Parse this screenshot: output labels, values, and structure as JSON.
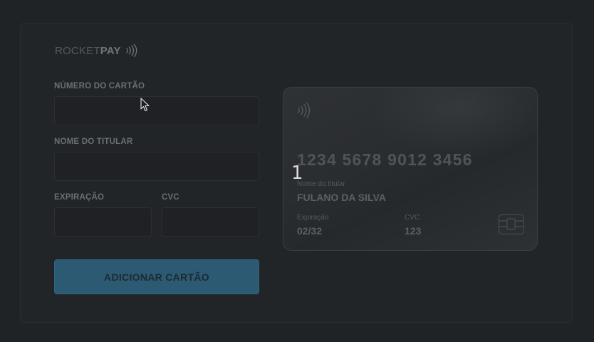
{
  "brand": {
    "name_light": "ROCKET",
    "name_bold": "PAY"
  },
  "form": {
    "card_number_label": "NÚMERO DO CARTÃO",
    "card_number_value": "",
    "holder_label": "NOME DO TITULAR",
    "holder_value": "",
    "expiration_label": "EXPIRAÇÃO",
    "expiration_value": "",
    "cvc_label": "CVC",
    "cvc_value": "",
    "submit_label": "ADICIONAR CARTÃO"
  },
  "card": {
    "number": "1234 5678 9012 3456",
    "holder_caption": "Nome do titular",
    "holder_name": "FULANO DA SILVA",
    "expiration_caption": "Expiração",
    "expiration_value": "02/32",
    "cvc_caption": "CVC",
    "cvc_value": "123"
  },
  "overlay": {
    "typed_digit": "1"
  },
  "icons": {
    "contactless": "contactless-icon",
    "chip": "chip-icon",
    "cursor": "cursor-arrow-icon"
  },
  "colors": {
    "accent": "#2b5a72",
    "background": "#202326"
  }
}
